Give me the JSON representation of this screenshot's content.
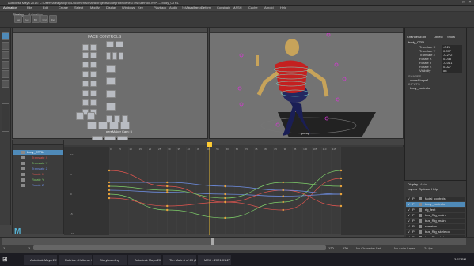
{
  "window": {
    "title": "Autodesk Maya 2018: C:\\Users\\Meagan\\proj\\Documents\\maya\\projects\\Blueprint\\scenes\\TestSkeRollt.mb* --- body_CTRL"
  },
  "menubar": {
    "items": [
      "Animation",
      "File",
      "Edit",
      "Create",
      "Select",
      "Modify",
      "Display",
      "Windows",
      "Key",
      "Playback",
      "Audio",
      "Visualize",
      "Deform",
      "Constrain",
      "MASH",
      "Cache",
      "Arnold",
      "Help"
    ],
    "workspace": "No Live Surface"
  },
  "shelf": {
    "tabs": [
      "Rigging",
      "Animation"
    ],
    "buttons": [
      "Set",
      "Key",
      "BD",
      "Grd",
      "Del"
    ]
  },
  "viewport1": {
    "label": "picker",
    "panel_label": "persMaker Cam: 5",
    "control_text": "FACE CONTROLS"
  },
  "viewport2": {
    "label": "persp"
  },
  "channelbox": {
    "tabs": [
      "Channels",
      "Edit",
      "Object",
      "Show"
    ],
    "object": "body_CTRL",
    "channels": [
      {
        "name": "Translate X",
        "value": "-0.21"
      },
      {
        "name": "Translate Y",
        "value": "0.377"
      },
      {
        "name": "Translate Z",
        "value": "-0.272"
      },
      {
        "name": "Rotate X",
        "value": "0.078"
      },
      {
        "name": "Rotate Y",
        "value": "-0.041"
      },
      {
        "name": "Rotate Z",
        "value": "0.027"
      },
      {
        "name": "Visibility",
        "value": "on"
      }
    ],
    "shapes_header": "SHAPES",
    "shapes": [
      "curveShape1"
    ],
    "inputs_header": "INPUTS",
    "inputs": [
      "body_controls"
    ]
  },
  "outliner": {
    "items": [
      {
        "label": "body_CTRL",
        "color": "#ffffff"
      },
      {
        "label": "Translate X",
        "color": "#e0554f"
      },
      {
        "label": "Translate Y",
        "color": "#7fd06a"
      },
      {
        "label": "Translate Z",
        "color": "#6f8fe4"
      },
      {
        "label": "Rotate X",
        "color": "#e0554f"
      },
      {
        "label": "Rotate Y",
        "color": "#7fd06a"
      },
      {
        "label": "Rotate Z",
        "color": "#6f8fe4"
      }
    ]
  },
  "graph": {
    "ticks": [
      "0",
      "5",
      "10",
      "15",
      "20",
      "25",
      "30",
      "35",
      "40",
      "45",
      "50",
      "55",
      "60",
      "65",
      "70",
      "75",
      "80",
      "85",
      "90",
      "95",
      "100",
      "105",
      "110",
      "115",
      "120"
    ],
    "y_labels": [
      "10",
      "5",
      "0",
      "-5",
      "-10"
    ],
    "current_frame": "52"
  },
  "layers": {
    "tabs": [
      "Display",
      "Anim"
    ],
    "menu": [
      "Layers",
      "Options",
      "Help"
    ],
    "items": [
      "facial_controls",
      "body_controls",
      "rig_feet",
      "bus_Rig_main",
      "bus_Rig_main",
      "skeleton",
      "bus_Rig_skeleton",
      "bus_Rig_skeleton"
    ]
  },
  "timeline": {
    "start": "1",
    "start_inner": "1",
    "end_inner": "120",
    "end": "120",
    "current": "52",
    "character_set": "No Character Set",
    "anim_layer": "No Anim Layer",
    "fps": "24 fps"
  },
  "taskbar": {
    "items": [
      "Autodesk Maya 2018",
      "Rubrics - Kaltura - Brave",
      "Storyboarding",
      "Autodesk Maya 2018",
      "Tim Maltr-1 of 89 (29...",
      "MEG - 2021-01-27 - 00..."
    ],
    "clock": "3:57 PM"
  },
  "colors": {
    "accent": "#58b6d9",
    "playhead": "#ffcc33",
    "selection": "#4f8ab8"
  }
}
